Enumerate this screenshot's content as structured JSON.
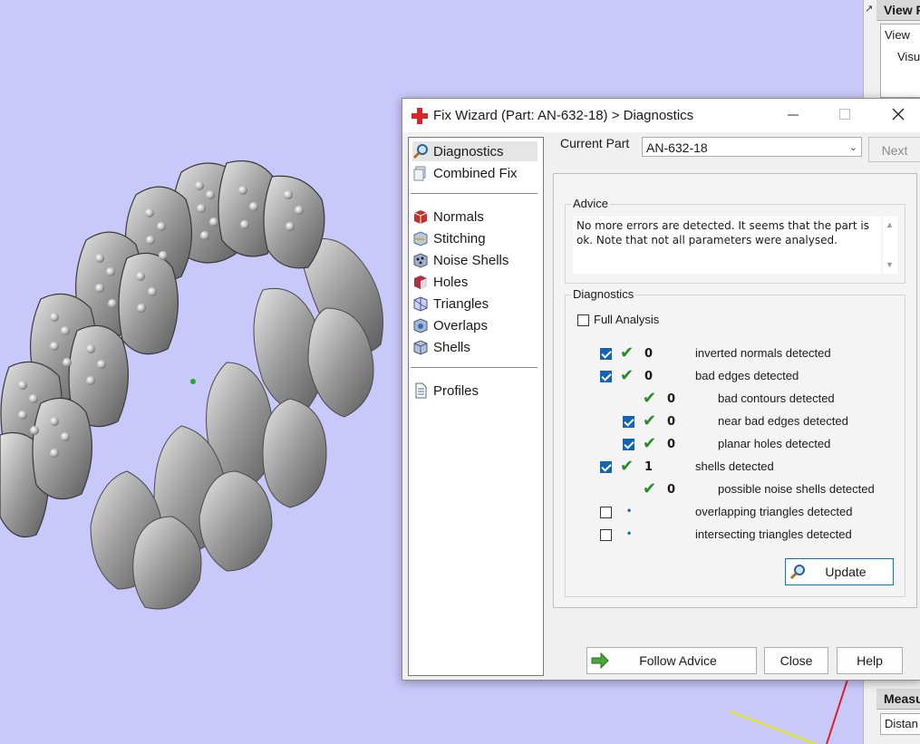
{
  "host_panel": {
    "title": "View P",
    "view_field": "View",
    "visual_field": "Visu",
    "measure_title": "Measu",
    "distance_field": "Distan"
  },
  "dialog": {
    "title": "Fix Wizard (Part: AN-632-18) > Diagnostics",
    "nav": {
      "top": [
        "Diagnostics",
        "Combined Fix"
      ],
      "tools": [
        "Normals",
        "Stitching",
        "Noise Shells",
        "Holes",
        "Triangles",
        "Overlaps",
        "Shells"
      ],
      "bottom": [
        "Profiles"
      ]
    },
    "current_part_label": "Current Part",
    "current_part_value": "AN-632-18",
    "next_label": "Next",
    "advice_title": "Advice",
    "advice_text": "No more errors are detected. It seems that the part is ok. Note that not all parameters were analysed.",
    "diagnostics_title": "Diagnostics",
    "full_analysis_label": "Full Analysis",
    "full_analysis_checked": false,
    "rows": [
      {
        "checked": true,
        "status": "ok",
        "count": "0",
        "label": "inverted normals detected"
      },
      {
        "checked": true,
        "status": "ok",
        "count": "0",
        "label": "bad edges detected"
      },
      {
        "checked": null,
        "status": "ok",
        "count": "0",
        "label": "bad contours detected"
      },
      {
        "checked": true,
        "status": "ok",
        "count": "0",
        "label": "near bad edges detected"
      },
      {
        "checked": true,
        "status": "ok",
        "count": "0",
        "label": "planar holes detected"
      },
      {
        "checked": true,
        "status": "ok",
        "count": "1",
        "label": "shells detected"
      },
      {
        "checked": null,
        "status": "ok",
        "count": "0",
        "label": "possible noise shells detected"
      },
      {
        "checked": false,
        "status": "unknown",
        "count": "",
        "label": "overlapping triangles detected"
      },
      {
        "checked": false,
        "status": "unknown",
        "count": "",
        "label": "intersecting triangles detected"
      }
    ],
    "update_label": "Update",
    "follow_advice_label": "Follow Advice",
    "close_label": "Close",
    "help_label": "Help"
  },
  "colors": {
    "viewport_bg": "#c8c8fa",
    "accent": "#1464b4",
    "ok_green": "#2a8a2a"
  }
}
